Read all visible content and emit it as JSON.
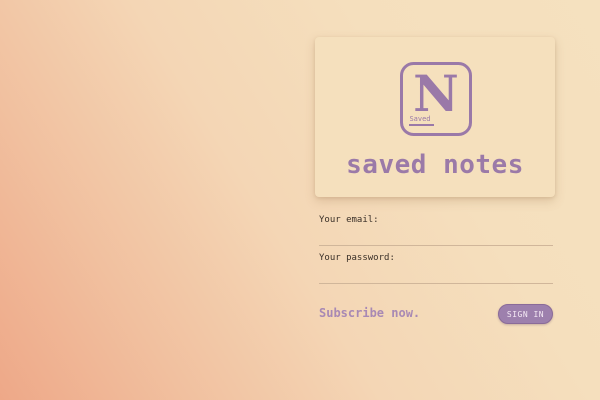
{
  "brand": {
    "name": "saved notes",
    "logo_letter": "N",
    "logo_caption": "Saved"
  },
  "form": {
    "email": {
      "label": "Your email:",
      "value": ""
    },
    "password": {
      "label": "Your password:",
      "value": ""
    },
    "subscribe_label": "Subscribe now.",
    "signin_label": "SIGN IN"
  },
  "colors": {
    "accent": "#9b7aa8",
    "button_bg": "#9d80ad",
    "card_bg": "#f5e0bd",
    "gradient_start": "#eea888",
    "gradient_end": "#f5e1bf"
  }
}
